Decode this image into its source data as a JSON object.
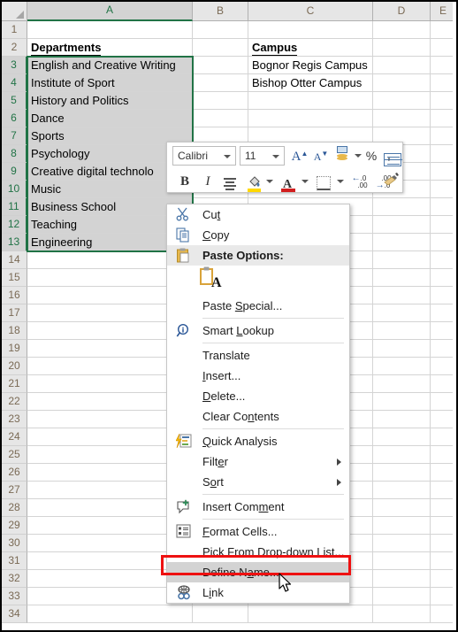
{
  "app": "Microsoft Excel",
  "grid": {
    "column_headers": [
      "A",
      "B",
      "C",
      "D",
      "E"
    ],
    "selected_column": "A",
    "row_headers": [
      "1",
      "2",
      "3",
      "4",
      "5",
      "6",
      "7",
      "8",
      "9",
      "10",
      "11",
      "12",
      "13",
      "14",
      "15",
      "16",
      "17",
      "18",
      "19",
      "20",
      "21",
      "22",
      "23",
      "24",
      "25",
      "26",
      "27",
      "28",
      "29",
      "30",
      "31",
      "32",
      "33",
      "34"
    ],
    "selected_rows": [
      "3",
      "4",
      "5",
      "6",
      "7",
      "8",
      "9",
      "10",
      "11",
      "12",
      "13"
    ],
    "selection_range": "A3:A13",
    "cells": {
      "A2": "Departments",
      "A3": "English and Creative Writing",
      "A4": "Institute of Sport",
      "A5": "History and Politics",
      "A6": "Dance",
      "A7": "Sports",
      "A8": "Psychology",
      "A9": "Creative digital technolo",
      "A10": "Music",
      "A11": "Business School",
      "A12": "Teaching",
      "A13": "Engineering",
      "C2": "Campus",
      "C3": "Bognor Regis Campus",
      "C4": "Bishop Otter Campus"
    }
  },
  "mini_toolbar": {
    "font_name": "Calibri",
    "font_size": "11",
    "buttons": [
      {
        "name": "increase-font-size",
        "label": "A"
      },
      {
        "name": "decrease-font-size",
        "label": "A"
      },
      {
        "name": "accounting-number-format",
        "label": ""
      },
      {
        "name": "percent-style",
        "label": "%"
      },
      {
        "name": "comma-style",
        "label": ","
      },
      {
        "name": "merge-and-center",
        "label": ""
      },
      {
        "name": "bold",
        "label": "B"
      },
      {
        "name": "italic",
        "label": "I"
      },
      {
        "name": "center-align",
        "label": ""
      },
      {
        "name": "fill-color",
        "label": ""
      },
      {
        "name": "font-color",
        "label": "A"
      },
      {
        "name": "borders",
        "label": ""
      },
      {
        "name": "decrease-decimal",
        "label": ".00"
      },
      {
        "name": "increase-decimal",
        "label": ".00"
      },
      {
        "name": "format-painter",
        "label": ""
      }
    ]
  },
  "context_menu": {
    "items": [
      {
        "id": "cut",
        "label": "Cut",
        "icon": "scissors-icon",
        "state": "normal",
        "submenu": false,
        "sep_after": false
      },
      {
        "id": "copy",
        "label": "Copy",
        "icon": "copy-icon",
        "state": "normal",
        "submenu": false,
        "sep_after": false
      },
      {
        "id": "paste-options",
        "label": "Paste Options:",
        "icon": "clipboard-icon",
        "state": "header",
        "submenu": false,
        "sep_after": false
      },
      {
        "id": "paste-keep-text",
        "label": "",
        "icon": "paste-text-icon",
        "state": "paste-gallery",
        "submenu": false,
        "sep_after": false
      },
      {
        "id": "paste-special",
        "label": "Paste Special...",
        "icon": "",
        "state": "normal",
        "submenu": false,
        "sep_after": true
      },
      {
        "id": "smart-lookup",
        "label": "Smart Lookup",
        "icon": "smart-lookup-icon",
        "state": "normal",
        "submenu": false,
        "sep_after": true
      },
      {
        "id": "translate",
        "label": "Translate",
        "icon": "",
        "state": "normal",
        "submenu": false,
        "sep_after": false
      },
      {
        "id": "insert",
        "label": "Insert...",
        "icon": "",
        "state": "normal",
        "submenu": false,
        "sep_after": false
      },
      {
        "id": "delete",
        "label": "Delete...",
        "icon": "",
        "state": "normal",
        "submenu": false,
        "sep_after": false
      },
      {
        "id": "clear-contents",
        "label": "Clear Contents",
        "icon": "",
        "state": "normal",
        "submenu": false,
        "sep_after": true
      },
      {
        "id": "quick-analysis",
        "label": "Quick Analysis",
        "icon": "quick-analysis-icon",
        "state": "normal",
        "submenu": false,
        "sep_after": false
      },
      {
        "id": "filter",
        "label": "Filter",
        "icon": "",
        "state": "normal",
        "submenu": true,
        "sep_after": false
      },
      {
        "id": "sort",
        "label": "Sort",
        "icon": "",
        "state": "normal",
        "submenu": true,
        "sep_after": true
      },
      {
        "id": "insert-comment",
        "label": "Insert Comment",
        "icon": "comment-icon",
        "state": "normal",
        "submenu": false,
        "sep_after": true
      },
      {
        "id": "format-cells",
        "label": "Format Cells...",
        "icon": "format-cells-icon",
        "state": "normal",
        "submenu": false,
        "sep_after": false
      },
      {
        "id": "pick-from-dropdown-list",
        "label": "Pick From Drop-down List...",
        "icon": "",
        "state": "normal",
        "submenu": false,
        "sep_after": false
      },
      {
        "id": "define-name",
        "label": "Define Name...",
        "icon": "",
        "state": "highlighted",
        "submenu": false,
        "sep_after": false
      },
      {
        "id": "link",
        "label": "Link",
        "icon": "link-icon",
        "state": "normal",
        "submenu": false,
        "sep_after": false
      }
    ]
  },
  "annotation": {
    "highlight_target": "Define Name...",
    "box_color": "#ee1111"
  },
  "colors": {
    "excel_green": "#217346",
    "header_gray": "#e6e6e6",
    "selection_gray": "#d3d3d3",
    "annotation_red": "#ee1111"
  }
}
